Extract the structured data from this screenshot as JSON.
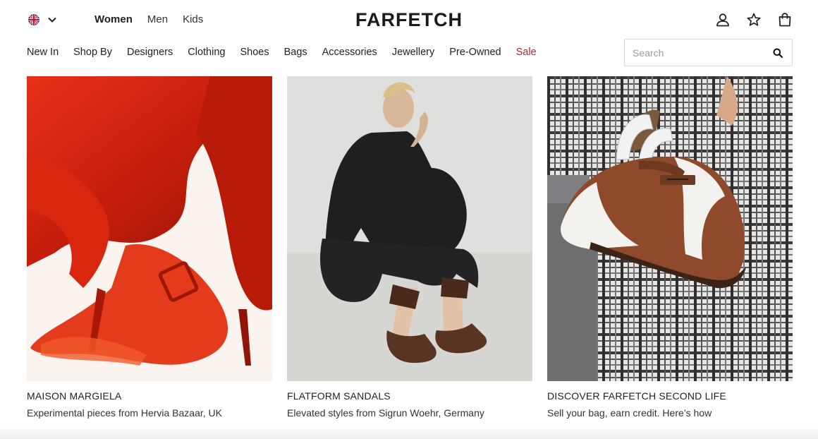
{
  "header": {
    "locale_flag": "uk-flag-icon",
    "gender_tabs": [
      {
        "label": "Women",
        "active": true
      },
      {
        "label": "Men",
        "active": false
      },
      {
        "label": "Kids",
        "active": false
      }
    ],
    "logo": "FARFETCH",
    "icons": [
      "account-icon",
      "wishlist-star-icon",
      "shopping-bag-icon"
    ]
  },
  "nav": {
    "items": [
      "New In",
      "Shop By",
      "Designers",
      "Clothing",
      "Shoes",
      "Bags",
      "Accessories",
      "Jewellery",
      "Pre-Owned",
      "Sale"
    ],
    "sale_color": "#b3262d"
  },
  "search": {
    "placeholder": "Search",
    "value": ""
  },
  "cards": [
    {
      "title": "MAISON MARGIELA",
      "subtitle": "Experimental pieces from Hervia Bazaar, UK"
    },
    {
      "title": "FLATFORM SANDALS",
      "subtitle": "Elevated styles from Sigrun Woehr, Germany"
    },
    {
      "title": "DISCOVER FARFETCH SECOND LIFE",
      "subtitle": "Sell your bag, earn credit. Here’s how"
    }
  ]
}
